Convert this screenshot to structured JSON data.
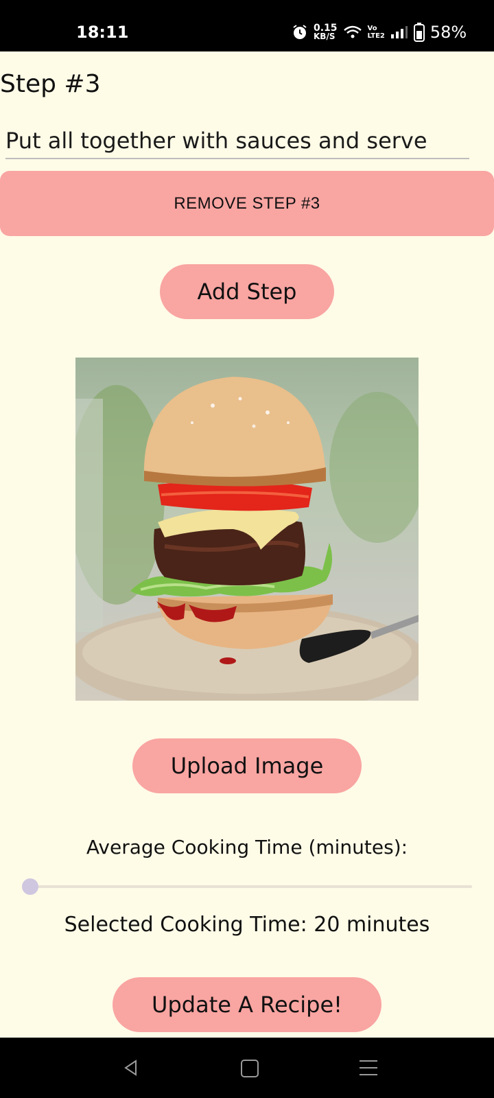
{
  "status_bar": {
    "time": "18:11",
    "net_speed_value": "0.15",
    "net_speed_unit": "KB/S",
    "lte_top": "Vo",
    "lte_bottom": "LTE2",
    "battery": "58%",
    "icons": [
      "alarm-icon",
      "wifi-icon",
      "signal-icon",
      "battery-icon"
    ]
  },
  "step": {
    "title": "Step #3",
    "description": "Put all together with sauces and serve",
    "remove_label": "REMOVE STEP #3"
  },
  "add_step_label": "Add Step",
  "image": {
    "subject": "burger-photo"
  },
  "upload_label": "Upload Image",
  "cooking_time": {
    "label": "Average Cooking Time (minutes):",
    "selected_text": "Selected Cooking Time: 20 minutes",
    "slider_value_fraction": 0.0
  },
  "submit_label": "Update A Recipe!",
  "colors": {
    "background": "#FEFBE7",
    "button": "#F9A5A2",
    "slider_thumb": "#CFC7E0"
  }
}
